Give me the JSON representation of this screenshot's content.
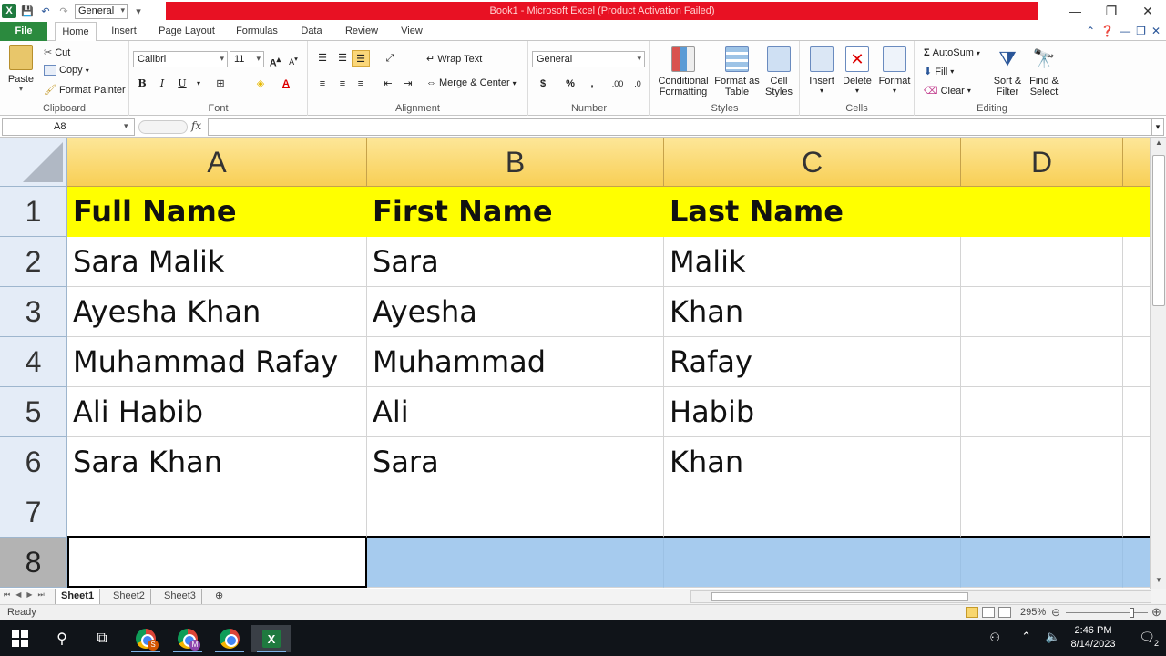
{
  "titlebar": {
    "title": "Book1 - Microsoft Excel (Product Activation Failed)",
    "qat_combo": "General"
  },
  "tabs": [
    "File",
    "Home",
    "Insert",
    "Page Layout",
    "Formulas",
    "Data",
    "Review",
    "View"
  ],
  "ribbon": {
    "clipboard": {
      "label": "Clipboard",
      "paste": "Paste",
      "cut": "Cut",
      "copy": "Copy",
      "format_painter": "Format Painter"
    },
    "font": {
      "label": "Font",
      "name": "Calibri",
      "size": "11",
      "bold": "B",
      "italic": "I",
      "underline": "U"
    },
    "alignment": {
      "label": "Alignment",
      "wrap": "Wrap Text",
      "merge": "Merge & Center"
    },
    "number": {
      "label": "Number",
      "format": "General",
      "currency": "$",
      "percent": "%",
      "comma": ","
    },
    "styles": {
      "label": "Styles",
      "conditional": "Conditional Formatting",
      "format_table": "Format as Table",
      "cell_styles": "Cell Styles"
    },
    "cells": {
      "label": "Cells",
      "insert": "Insert",
      "delete": "Delete",
      "format": "Format"
    },
    "editing": {
      "label": "Editing",
      "autosum": "AutoSum",
      "fill": "Fill",
      "clear": "Clear",
      "sort": "Sort & Filter",
      "find": "Find & Select"
    }
  },
  "formula_bar": {
    "name_box": "A8",
    "fx": "fx",
    "formula": ""
  },
  "grid": {
    "columns": [
      "A",
      "B",
      "C",
      "D"
    ],
    "rows": [
      [
        "Full Name",
        "First Name",
        "Last Name",
        ""
      ],
      [
        "Sara Malik",
        "Sara",
        "Malik",
        ""
      ],
      [
        "Ayesha Khan",
        "Ayesha",
        "Khan",
        ""
      ],
      [
        "Muhammad Rafay",
        "Muhammad",
        "Rafay",
        ""
      ],
      [
        "Ali Habib",
        "Ali",
        "Habib",
        ""
      ],
      [
        "Sara Khan",
        "Sara",
        "Khan",
        ""
      ],
      [
        "",
        "",
        "",
        ""
      ],
      [
        "",
        "",
        "",
        ""
      ]
    ],
    "row_numbers": [
      "1",
      "2",
      "3",
      "4",
      "5",
      "6",
      "7",
      "8"
    ]
  },
  "sheets": [
    "Sheet1",
    "Sheet2",
    "Sheet3"
  ],
  "status": {
    "text": "Ready",
    "zoom": "295%"
  },
  "taskbar": {
    "time": "2:46 PM",
    "date": "8/14/2023",
    "notif_count": "2"
  },
  "colors": {
    "header_fill": "#ffff00",
    "selection": "#a6cbee",
    "file_tab": "#2b8a3e",
    "title_bar": "#e81123"
  }
}
